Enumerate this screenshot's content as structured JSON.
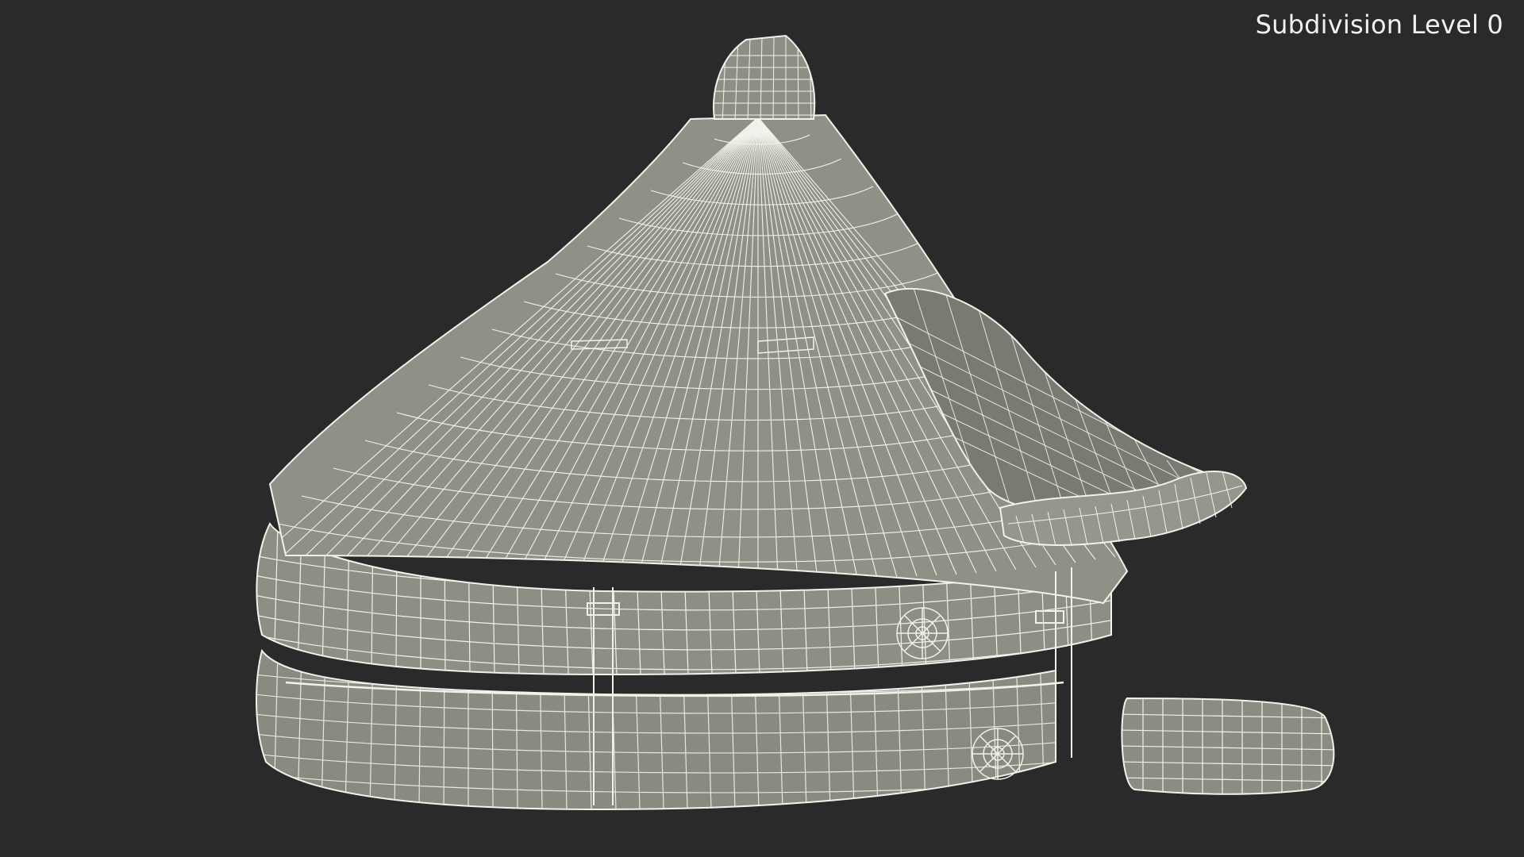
{
  "overlay": {
    "label": "Subdivision Level 0"
  },
  "colors": {
    "background": "#2a2a2a",
    "surface": "#8e8e84",
    "wire": "#f2f2ec",
    "label": "#f2f2f2"
  },
  "model": {
    "icon": "liferaft-wireframe-icon"
  }
}
